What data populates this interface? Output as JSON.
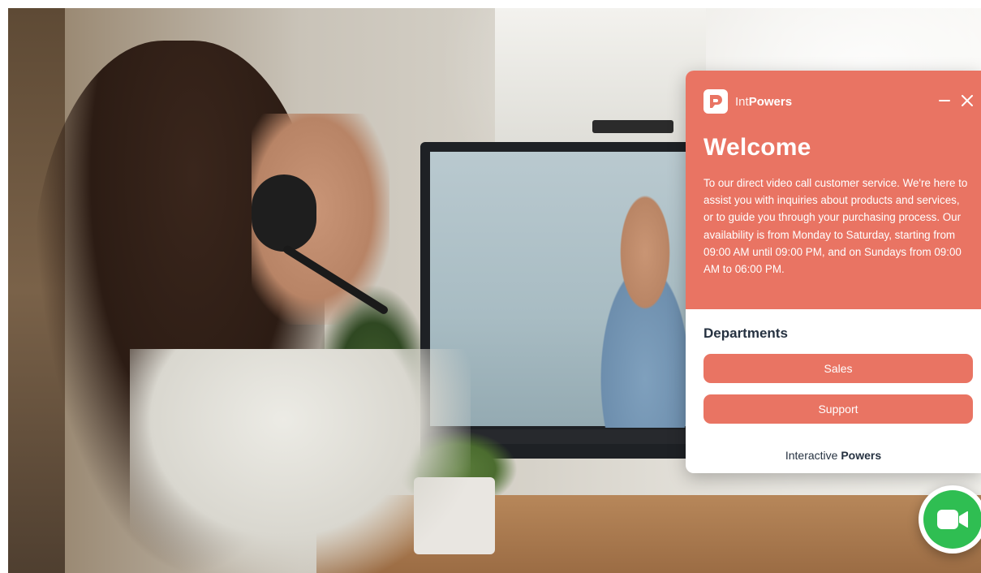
{
  "widget": {
    "brand": {
      "prefix": "Int",
      "name": "Powers",
      "logo_icon": "intpowers-logo-icon"
    },
    "controls": {
      "minimize_icon": "minimize-icon",
      "close_icon": "close-icon"
    },
    "welcome": {
      "title": "Welcome",
      "text": "To our direct video call customer service. We're here to assist you with inquiries about products and services, or to guide you through your purchasing process. Our availability is from Monday to Saturday, starting from 09:00 AM until 09:00 PM, and on Sundays from 09:00 AM to 06:00 PM."
    },
    "departments": {
      "title": "Departments",
      "buttons": [
        {
          "label": "Sales"
        },
        {
          "label": "Support"
        }
      ]
    },
    "footer": {
      "prefix": "Interactive",
      "name": "Powers"
    }
  },
  "video_button": {
    "icon": "video-camera-icon"
  },
  "colors": {
    "accent": "#e97463",
    "dark_text": "#263241",
    "video_green": "#2fbe52"
  }
}
